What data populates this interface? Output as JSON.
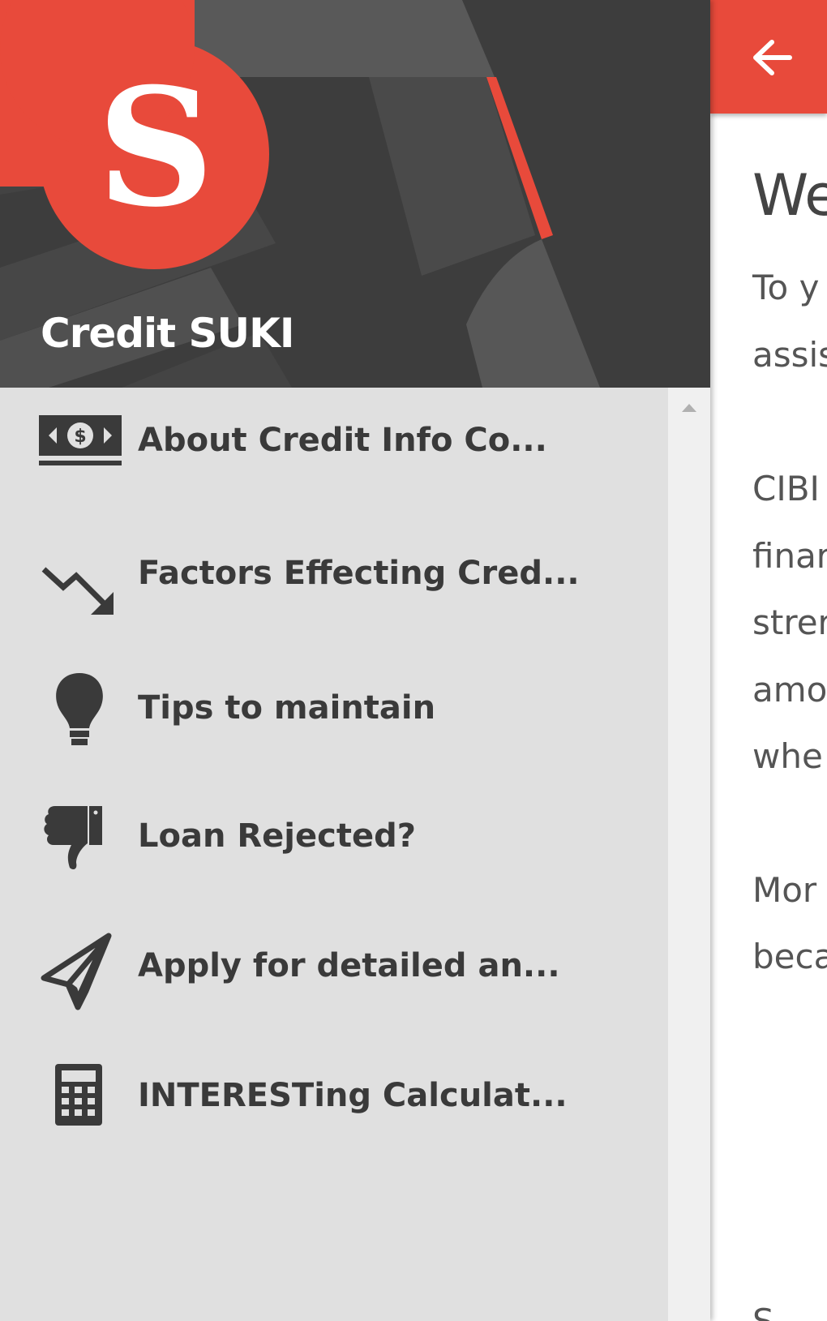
{
  "app": {
    "name": "Credit SUKI",
    "logo_letter": "S"
  },
  "colors": {
    "accent": "#e84a3b",
    "header_bg": "#3d3d3d",
    "drawer_bg": "#e0e0e0",
    "text": "#3a3a3a"
  },
  "menu": {
    "items": [
      {
        "icon": "money-bill-icon",
        "label": "About Credit Info Co..."
      },
      {
        "icon": "trending-down-icon",
        "label": "Factors Effecting Cred..."
      },
      {
        "icon": "lightbulb-icon",
        "label": "Tips to maintain"
      },
      {
        "icon": "thumbs-down-icon",
        "label": "Loan Rejected?"
      },
      {
        "icon": "paper-plane-icon",
        "label": "Apply for detailed an..."
      },
      {
        "icon": "calculator-icon",
        "label": "INTERESTing Calculat..."
      }
    ]
  },
  "content": {
    "title": "We",
    "lines": [
      "To y",
      "assis",
      "CIBI",
      "finar",
      "strer",
      "amo",
      "whe",
      "Mor",
      "beca",
      "S"
    ]
  }
}
